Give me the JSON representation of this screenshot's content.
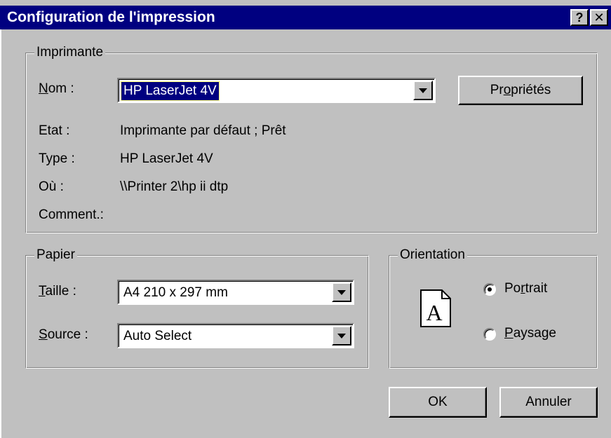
{
  "window": {
    "title": "Configuration de l'impression",
    "help_button": "?",
    "close_button": "✕"
  },
  "printer": {
    "group_label": "Imprimante",
    "name_label": "Nom :",
    "name_value": "HP LaserJet 4V",
    "properties_button": "Propriétés",
    "state_label": "Etat :",
    "state_value": "Imprimante par défaut ; Prêt",
    "type_label": "Type :",
    "type_value": "HP LaserJet 4V",
    "where_label": "Où :",
    "where_value": "\\\\Printer 2\\hp ii dtp",
    "comment_label": "Comment.:",
    "comment_value": ""
  },
  "paper": {
    "group_label": "Papier",
    "size_label": "Taille :",
    "size_value": "A4 210 x 297 mm",
    "source_label": "Source :",
    "source_value": "Auto Select"
  },
  "orientation": {
    "group_label": "Orientation",
    "icon_letter": "A",
    "portrait_label": "Portrait",
    "portrait_checked": true,
    "landscape_label": "Paysage",
    "landscape_checked": false
  },
  "buttons": {
    "ok": "OK",
    "cancel": "Annuler"
  },
  "icons": {
    "help": "help-icon",
    "close": "close-icon",
    "dropdown": "chevron-down-icon",
    "page": "portrait-page-icon"
  },
  "colors": {
    "titlebar": "#000080",
    "face": "#c0c0c0",
    "selection": "#000080"
  }
}
